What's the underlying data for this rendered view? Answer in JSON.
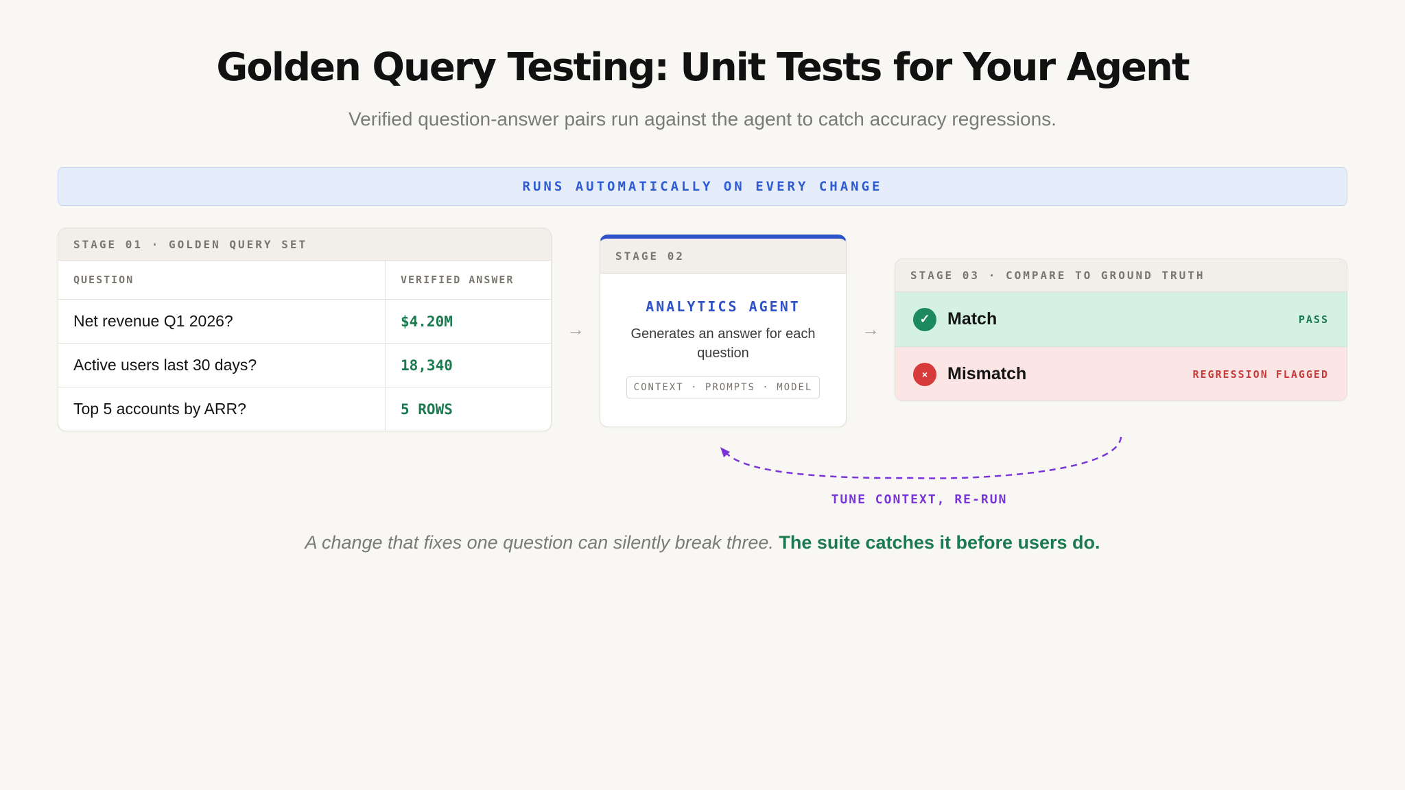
{
  "title": "Golden Query Testing: Unit Tests for Your Agent",
  "subtitle": "Verified question-answer pairs run against the agent to catch accuracy regressions.",
  "banner": "RUNS AUTOMATICALLY ON EVERY CHANGE",
  "stage1": {
    "header": "STAGE 01 · GOLDEN QUERY SET",
    "col_question": "QUESTION",
    "col_answer": "VERIFIED ANSWER",
    "rows": [
      {
        "question": "Net revenue Q1 2026?",
        "answer": "$4.20M"
      },
      {
        "question": "Active users last 30 days?",
        "answer": "18,340"
      },
      {
        "question": "Top 5 accounts by ARR?",
        "answer": "5 ROWS"
      }
    ]
  },
  "arrow_glyph": "→",
  "stage2": {
    "header": "STAGE 02",
    "name": "ANALYTICS AGENT",
    "description": "Generates an answer for each question",
    "tags": "CONTEXT · PROMPTS · MODEL"
  },
  "stage3": {
    "header": "STAGE 03 · COMPARE TO GROUND TRUTH",
    "match": {
      "icon": "check-icon",
      "glyph": "✓",
      "label": "Match",
      "tag": "PASS"
    },
    "mismatch": {
      "icon": "x-icon",
      "glyph": "×",
      "label": "Mismatch",
      "tag": "REGRESSION FLAGGED"
    }
  },
  "loop_label": "TUNE CONTEXT, RE-RUN",
  "footer": {
    "muted": "A change that fixes one question can silently break three.",
    "strong": "The suite catches it before users do."
  },
  "colors": {
    "accent_blue": "#2f52c8",
    "pass_green": "#1c7a50",
    "fail_red": "#c63a3a",
    "loop_purple": "#7a35d6"
  }
}
